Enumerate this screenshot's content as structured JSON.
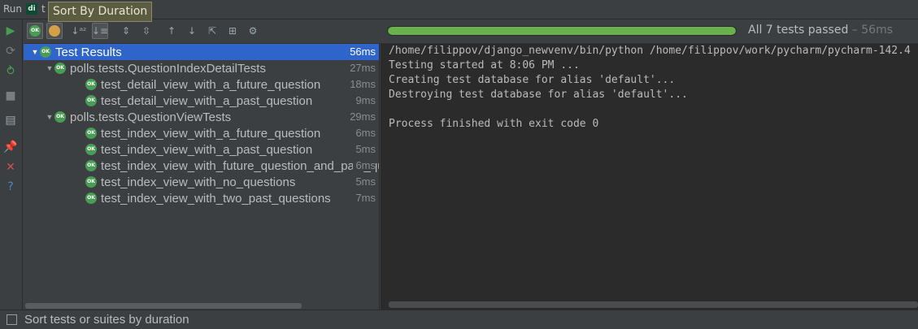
{
  "window": {
    "run_label": "Run",
    "config_icon": "django-icon",
    "config_text": "di",
    "tab_fragment": "t"
  },
  "tooltip": "Sort By Duration",
  "left_toolbar": [
    {
      "name": "rerun-icon",
      "glyph": "▶",
      "color": "#499c54"
    },
    {
      "name": "toggle-auto-test-icon",
      "glyph": "⟳",
      "color": "#7a7d80"
    },
    {
      "name": "rerun-failed-icon",
      "glyph": "⥁",
      "color": "#499c54"
    },
    {
      "name": "stop-icon",
      "glyph": "■",
      "color": "#7a7d80"
    },
    {
      "name": "layout-icon",
      "glyph": "▤",
      "color": "#9aa7b0"
    },
    {
      "name": "pin-icon",
      "glyph": "📌",
      "color": "#9a8ab0"
    },
    {
      "name": "close-icon",
      "glyph": "✕",
      "color": "#c75450"
    },
    {
      "name": "help-icon",
      "glyph": "?",
      "color": "#4a88c7"
    }
  ],
  "tree_toolbar": [
    {
      "name": "show-passed-icon",
      "type": "ok",
      "on": true
    },
    {
      "name": "show-ignored-icon",
      "type": "ign",
      "on": true
    },
    {
      "name": "sort-alphabetically-icon",
      "glyph": "↓ᵃᶻ",
      "on": false
    },
    {
      "name": "sort-by-duration-icon",
      "glyph": "↓≡",
      "on": true
    },
    {
      "name": "expand-all-icon",
      "glyph": "⇕",
      "on": false
    },
    {
      "name": "collapse-all-icon",
      "glyph": "⇳",
      "on": false
    },
    {
      "name": "previous-icon",
      "glyph": "↑",
      "on": false
    },
    {
      "name": "next-icon",
      "glyph": "↓",
      "on": false
    },
    {
      "name": "export-icon",
      "glyph": "⇱",
      "on": false
    },
    {
      "name": "import-icon",
      "glyph": "⊞",
      "on": false
    },
    {
      "name": "settings-icon",
      "glyph": "⚙",
      "on": false
    }
  ],
  "progress": {
    "fraction": 1.0,
    "passed_text": "All 7 tests passed",
    "separator": " – ",
    "duration": "56ms"
  },
  "tree": [
    {
      "label": "Test Results",
      "time": "56ms",
      "level": 0,
      "arrow": "▼",
      "selected": true
    },
    {
      "label": "polls.tests.QuestionIndexDetailTests",
      "time": "27ms",
      "level": 1,
      "arrow": "▼",
      "selected": false
    },
    {
      "label": "test_detail_view_with_a_future_question",
      "time": "18ms",
      "level": 2,
      "arrow": "",
      "selected": false
    },
    {
      "label": "test_detail_view_with_a_past_question",
      "time": "9ms",
      "level": 2,
      "arrow": "",
      "selected": false
    },
    {
      "label": "polls.tests.QuestionViewTests",
      "time": "29ms",
      "level": 1,
      "arrow": "▼",
      "selected": false
    },
    {
      "label": "test_index_view_with_a_future_question",
      "time": "6ms",
      "level": 2,
      "arrow": "",
      "selected": false
    },
    {
      "label": "test_index_view_with_a_past_question",
      "time": "5ms",
      "level": 2,
      "arrow": "",
      "selected": false
    },
    {
      "label": "test_index_view_with_future_question_and_past_question",
      "time": "6ms",
      "level": 2,
      "arrow": "",
      "selected": false
    },
    {
      "label": "test_index_view_with_no_questions",
      "time": "5ms",
      "level": 2,
      "arrow": "",
      "selected": false
    },
    {
      "label": "test_index_view_with_two_past_questions",
      "time": "7ms",
      "level": 2,
      "arrow": "",
      "selected": false
    }
  ],
  "console": [
    "/home/filippov/django_newvenv/bin/python /home/filippov/work/pycharm/pycharm-142.4",
    "Testing started at 8:06 PM ...",
    "Creating test database for alias 'default'...",
    "Destroying test database for alias 'default'...",
    "",
    "Process finished with exit code 0"
  ],
  "statusbar": {
    "text": "Sort tests or suites by duration"
  }
}
